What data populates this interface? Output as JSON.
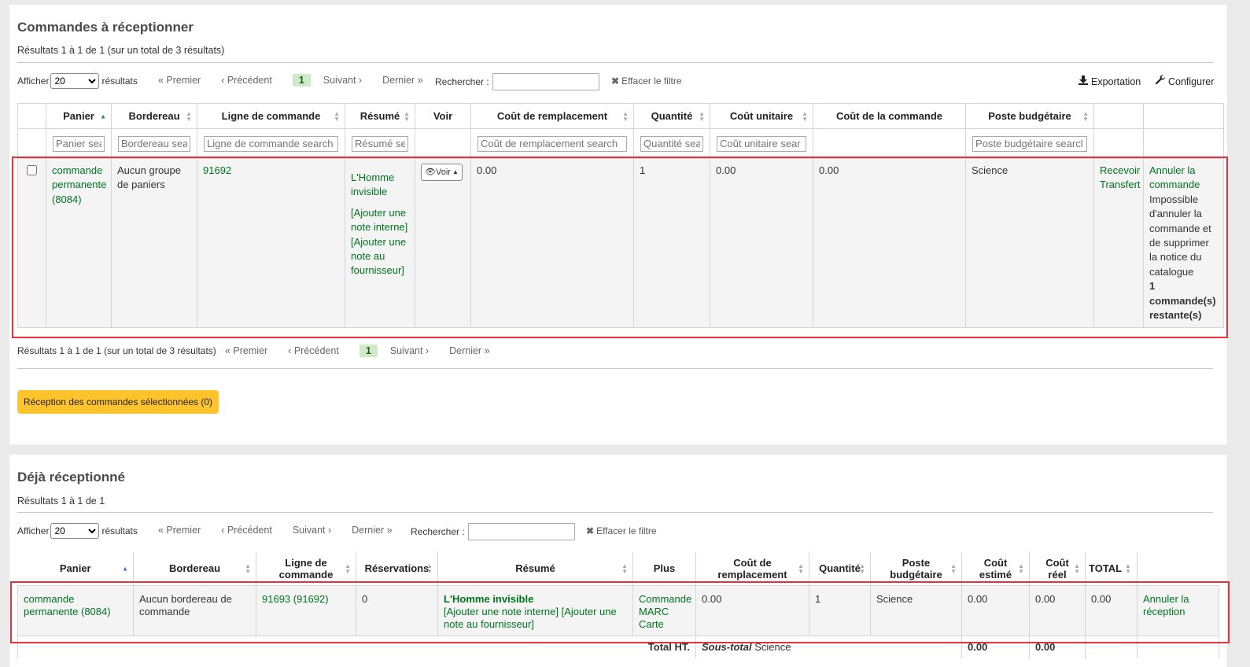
{
  "section1": {
    "title": "Commandes à réceptionner",
    "results_info": "Résultats 1 à 1 de 1 (sur un total de 3 résultats)",
    "show_label": "Afficher",
    "show_value": "20",
    "show_suffix": "résultats",
    "pager": {
      "first": "« Premier",
      "prev": "‹ Précédent",
      "current": "1",
      "next": "Suivant ›",
      "last": "Dernier »"
    },
    "search_label": "Rechercher :",
    "clear_filter": "Effacer le filtre",
    "export": "Exportation",
    "configure": "Configurer",
    "columns": [
      "",
      "Panier",
      "Bordereau",
      "Ligne de commande",
      "Résumé",
      "Voir",
      "Coût de remplacement",
      "Quantité",
      "Coût unitaire",
      "Coût de la commande",
      "Poste budgétaire",
      "",
      ""
    ],
    "filters": [
      "",
      "Panier sea",
      "Bordereau sea",
      "Ligne de commande search",
      "Résumé sea",
      "",
      "Coût de remplacement search",
      "Quantité sea",
      "Coût unitaire sear",
      "",
      "Poste budgétaire searcl",
      "",
      ""
    ],
    "row": {
      "basket_l1": "commande",
      "basket_l2": "permanente",
      "basket_l3": "(8084)",
      "group_l1": "Aucun groupe",
      "group_l2": "de paniers",
      "order_line": "91692",
      "title_l1": "L'Homme",
      "title_l2": "invisible",
      "note1_l1": "[Ajouter une",
      "note1_l2": "note interne]",
      "note2_l1": "[Ajouter une",
      "note2_l2": "note au",
      "note2_l3": "fournisseur]",
      "voir": "Voir",
      "replacement_cost": "0.00",
      "quantity": "1",
      "unit_cost": "0.00",
      "order_cost": "0.00",
      "fund": "Science",
      "receive": "Recevoir",
      "transfer": "Transfert",
      "cancel_l1": "Annuler la",
      "cancel_l2": "commande",
      "warn_l1": "Impossible",
      "warn_l2": "d'annuler la",
      "warn_l3": "commande et",
      "warn_l4": "de supprimer",
      "warn_l5": "la notice du",
      "warn_l6": "catalogue",
      "remain_l1": "1",
      "remain_l2": "commande(s)",
      "remain_l3": "restante(s)"
    },
    "bottom_info": "Résultats 1 à 1 de 1 (sur un total de 3 résultats)",
    "receive_button": "Réception des commandes sélectionnées (0)"
  },
  "section2": {
    "title": "Déjà réceptionné",
    "results_info": "Résultats 1 à 1 de 1",
    "show_label": "Afficher",
    "show_value": "20",
    "show_suffix": "résultats",
    "pager": {
      "first": "« Premier",
      "prev": "‹ Précédent",
      "next": "Suivant ›",
      "last": "Dernier »"
    },
    "search_label": "Rechercher :",
    "clear_filter": "Effacer le filtre",
    "columns": {
      "panier": "Panier",
      "bordereau": "Bordereau",
      "ligne_l1": "Ligne de",
      "ligne_l2": "commande",
      "reservations": "Réservations",
      "resume": "Résumé",
      "plus": "Plus",
      "cout_l1": "Coût de",
      "cout_l2": "remplacement",
      "quantite": "Quantité",
      "poste_l1": "Poste",
      "poste_l2": "budgétaire",
      "estime_l1": "Coût",
      "estime_l2": "estimé",
      "reel_l1": "Coût",
      "reel_l2": "réel",
      "total": "TOTAL"
    },
    "row": {
      "basket_l1": "commande",
      "basket_l2": "permanente (8084)",
      "invoice_l1": "Aucun bordereau de",
      "invoice_l2": "commande",
      "order_line": "91693 (91692)",
      "holds": "0",
      "title": "L'Homme invisible",
      "notes_l1": "[Ajouter une note interne] [Ajouter une",
      "notes_l2": "note au fournisseur]",
      "plus_l1": "Commande",
      "plus_l2": "MARC",
      "plus_l3": "Carte",
      "replacement_cost": "0.00",
      "quantity": "1",
      "fund": "Science",
      "est_cost": "0.00",
      "actual_cost": "0.00",
      "total": "0.00",
      "cancel_l1": "Annuler la",
      "cancel_l2": "réception"
    },
    "footer": {
      "total_label": "Total HT.",
      "subtotal_label": "Sous-total",
      "subtotal_fund": "Science",
      "est": "0.00",
      "actual": "0.00"
    }
  }
}
